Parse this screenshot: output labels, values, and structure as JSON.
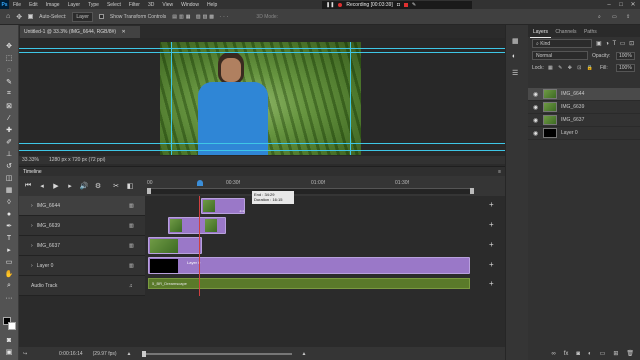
{
  "menu": {
    "logo": "Ps",
    "items": [
      "File",
      "Edit",
      "Image",
      "Layer",
      "Type",
      "Select",
      "Filter",
      "3D",
      "View",
      "Window",
      "Help"
    ]
  },
  "recording": {
    "label": "Recording [00:03:39]"
  },
  "options": {
    "auto_select_label": "Auto-Select:",
    "auto_select_value": "Layer",
    "show_transform_label": "Show Transform Controls",
    "mode_3d": "3D Mode:"
  },
  "document": {
    "tab_title": "Untitled-1 @ 33.3% (IMG_6644, RGB/8#)",
    "zoom": "33.33%",
    "size": "1280 px x 720 px (72 ppi)"
  },
  "timeline": {
    "title": "Timeline",
    "ruler": [
      "00",
      "00:30f",
      "01:00f",
      "01:30f"
    ],
    "tracks": [
      {
        "name": "IMG_6644"
      },
      {
        "name": "IMG_6639"
      },
      {
        "name": "IMG_6637"
      },
      {
        "name": "Layer 0"
      }
    ],
    "audio_track": "Audio Track",
    "clip_layer0": "Layer 0",
    "clip_audio": "5_BR_Dreamscape",
    "tooltip_end": "End : 34:29",
    "tooltip_duration": "Duration : 16:15",
    "current_time": "0:00:16:14",
    "fps": "(29.97 fps)"
  },
  "layers_panel": {
    "tabs": [
      "Layers",
      "Channels",
      "Paths"
    ],
    "kind": "Kind",
    "blend": "Normal",
    "opacity_label": "Opacity:",
    "opacity_value": "100%",
    "lock_label": "Lock:",
    "fill_label": "Fill:",
    "fill_value": "100%",
    "layers": [
      {
        "name": "IMG_6644",
        "selected": true
      },
      {
        "name": "IMG_6639",
        "selected": false
      },
      {
        "name": "IMG_6637",
        "selected": false
      },
      {
        "name": "Layer 0",
        "selected": false
      }
    ]
  },
  "colors": {
    "clip": "#9a78c8",
    "audio_clip": "#5a7a2a",
    "guide": "#3ec6e6",
    "recording": "#e03030"
  }
}
